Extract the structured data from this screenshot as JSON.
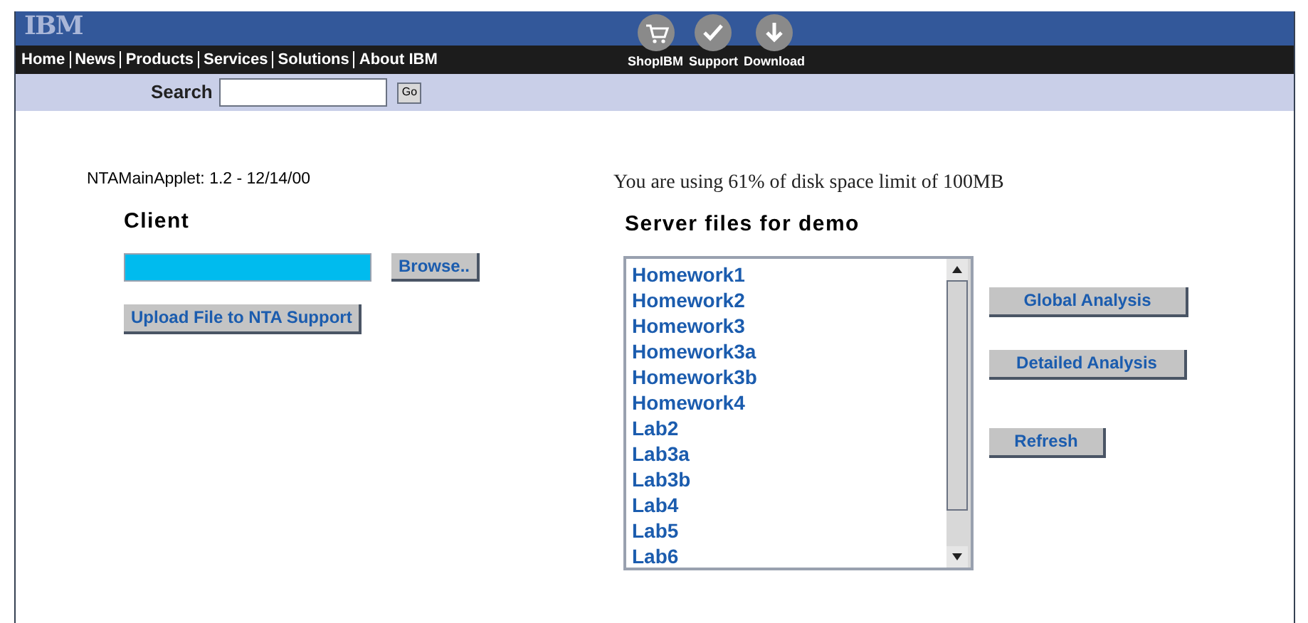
{
  "header": {
    "logo": "IBM",
    "nav": [
      "Home",
      "News",
      "Products",
      "Services",
      "Solutions",
      "About IBM"
    ],
    "tools": [
      {
        "kind": "cart",
        "label": "ShopIBM"
      },
      {
        "kind": "check",
        "label": "Support"
      },
      {
        "kind": "download",
        "label": "Download"
      }
    ],
    "search": {
      "label": "Search",
      "button": "Go"
    }
  },
  "applet": {
    "version": "NTAMainApplet: 1.2 - 12/14/00",
    "disk_usage": "You are using 61% of disk space limit of 100MB",
    "client": {
      "heading": "Client",
      "browse_button": "Browse..",
      "upload_button": "Upload File to NTA Support"
    },
    "server": {
      "heading": "Server files for demo",
      "files": [
        "Homework1",
        "Homework2",
        "Homework3",
        "Homework3a",
        "Homework3b",
        "Homework4",
        "Lab2",
        "Lab3a",
        "Lab3b",
        "Lab4",
        "Lab5",
        "Lab6"
      ],
      "buttons": [
        "Global Analysis",
        "Detailed Analysis",
        "Refresh"
      ]
    }
  }
}
